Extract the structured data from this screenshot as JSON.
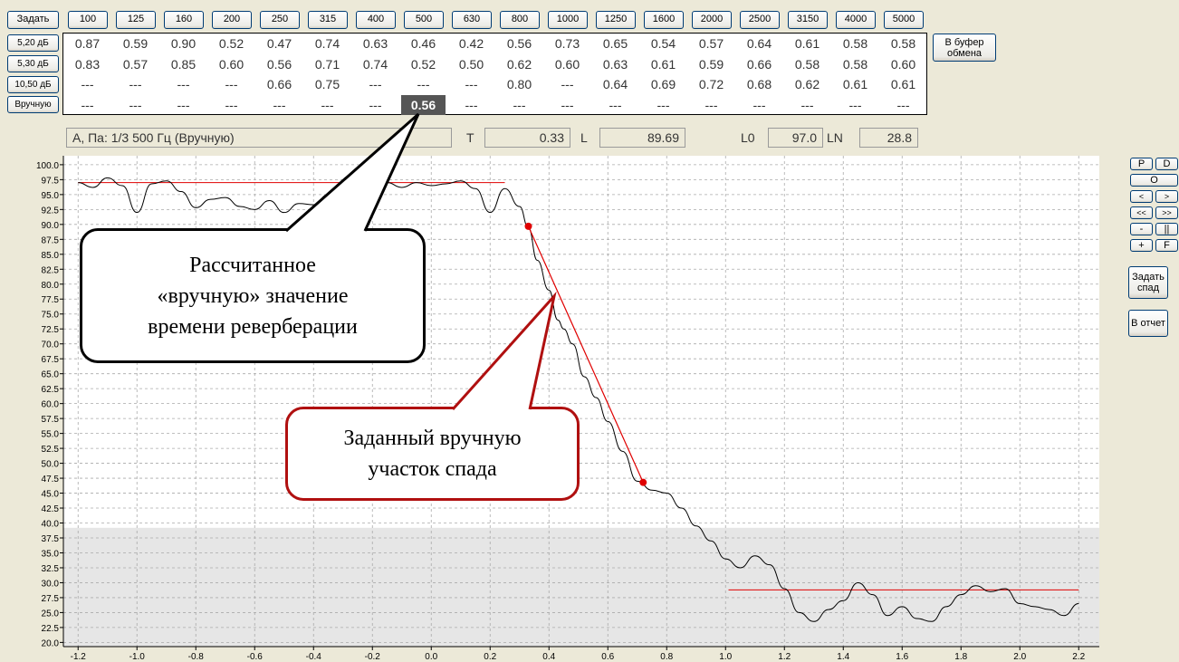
{
  "toolbar": {
    "set_label": "Задать"
  },
  "freq_headers": [
    "100",
    "125",
    "160",
    "200",
    "250",
    "315",
    "400",
    "500",
    "630",
    "800",
    "1000",
    "1250",
    "1600",
    "2000",
    "2500",
    "3150",
    "4000",
    "5000"
  ],
  "rows": [
    {
      "label": "5,20 дБ",
      "values": [
        "0.87",
        "0.59",
        "0.90",
        "0.52",
        "0.47",
        "0.74",
        "0.63",
        "0.46",
        "0.42",
        "0.56",
        "0.73",
        "0.65",
        "0.54",
        "0.57",
        "0.64",
        "0.61",
        "0.58",
        "0.58"
      ]
    },
    {
      "label": "5,30 дБ",
      "values": [
        "0.83",
        "0.57",
        "0.85",
        "0.60",
        "0.56",
        "0.71",
        "0.74",
        "0.52",
        "0.50",
        "0.62",
        "0.60",
        "0.63",
        "0.61",
        "0.59",
        "0.66",
        "0.58",
        "0.58",
        "0.60"
      ]
    },
    {
      "label": "10,50 дБ",
      "values": [
        "---",
        "---",
        "---",
        "---",
        "0.66",
        "0.75",
        "---",
        "---",
        "---",
        "0.80",
        "---",
        "0.64",
        "0.69",
        "0.72",
        "0.68",
        "0.62",
        "0.61",
        "0.61"
      ]
    },
    {
      "label": "Вручную",
      "values": [
        "---",
        "---",
        "---",
        "---",
        "---",
        "---",
        "---",
        "0.56",
        "---",
        "---",
        "---",
        "---",
        "---",
        "---",
        "---",
        "---",
        "---",
        "---"
      ],
      "highlight_index": 7
    }
  ],
  "clipboard_button": {
    "line1": "В буфер",
    "line2": "обмена"
  },
  "status": {
    "title": "А, Па: 1/3 500 Гц (Вручную)",
    "t_label": "T",
    "t_value": "0.33",
    "l_label": "L",
    "l_value": "89.69",
    "l0_label": "L0",
    "l0_value": "97.0",
    "ln_label": "LN",
    "ln_value": "28.8"
  },
  "side_buttons": {
    "p": "P",
    "d": "D",
    "o": "O",
    "lt": "<",
    "gt": ">",
    "llt": "<<",
    "ggt": ">>",
    "minus": "-",
    "pause": "||",
    "plus": "+",
    "f": "F",
    "set_decay_1": "Задать",
    "set_decay_2": "спад",
    "to_report": "В отчет"
  },
  "callouts": {
    "manual_value": [
      "Рассчитанное",
      "«вручную» значение",
      "времени реверберации"
    ],
    "manual_segment": [
      "Заданный вручную",
      "участок спада"
    ]
  },
  "chart_data": {
    "type": "line",
    "x_ticks": [
      "-1.2",
      "-1.0",
      "-0.8",
      "-0.6",
      "-0.4",
      "-0.2",
      "0.0",
      "0.2",
      "0.4",
      "0.6",
      "0.8",
      "1.0",
      "1.2",
      "1.4",
      "1.6",
      "1.8",
      "2.0",
      "2.2"
    ],
    "y_ticks": [
      "100.0",
      "97.5",
      "95.0",
      "92.5",
      "90.0",
      "87.5",
      "85.0",
      "82.5",
      "80.0",
      "77.5",
      "75.0",
      "72.5",
      "70.0",
      "67.5",
      "65.0",
      "62.5",
      "60.0",
      "57.5",
      "55.0",
      "52.5",
      "50.0",
      "47.5",
      "45.0",
      "42.5",
      "40.0",
      "37.5",
      "35.0",
      "32.5",
      "30.0",
      "27.5",
      "25.0",
      "22.5",
      "20.0"
    ],
    "xlim": [
      -1.25,
      2.27
    ],
    "ylim": [
      19.3,
      101.5
    ],
    "shaded_below": 39.2,
    "series": [
      {
        "x": [
          -1.2,
          -1.15,
          -1.1,
          -1.05,
          -1.0,
          -0.95,
          -0.9,
          -0.85,
          -0.8,
          -0.75,
          -0.7,
          -0.65,
          -0.6,
          -0.55,
          -0.5,
          -0.45,
          -0.4,
          -0.35,
          -0.3,
          -0.25,
          -0.2,
          -0.15,
          -0.1,
          -0.05,
          0.0,
          0.05,
          0.1,
          0.15,
          0.2,
          0.25,
          0.3,
          0.33,
          0.36,
          0.4,
          0.43,
          0.45,
          0.48,
          0.52,
          0.56,
          0.6,
          0.65,
          0.7,
          0.75,
          0.8,
          0.85,
          0.9,
          0.95,
          1.0,
          1.05,
          1.1,
          1.15,
          1.2,
          1.25,
          1.3,
          1.35,
          1.4,
          1.45,
          1.5,
          1.55,
          1.6,
          1.65,
          1.7,
          1.75,
          1.8,
          1.85,
          1.9,
          1.95,
          2.0,
          2.05,
          2.1,
          2.15,
          2.2
        ],
        "y": [
          97.0,
          96.2,
          97.8,
          96.5,
          92.0,
          96.8,
          97.3,
          95.5,
          92.8,
          94.2,
          94.5,
          93.0,
          92.5,
          94.0,
          92.0,
          93.5,
          93.3,
          95.0,
          94.5,
          96.0,
          94.2,
          97.0,
          96.2,
          97.0,
          96.5,
          96.8,
          97.3,
          96.0,
          92.0,
          96.0,
          93.0,
          89.5,
          84.0,
          79.0,
          74.0,
          72.5,
          70.0,
          64.5,
          61.0,
          57.0,
          52.0,
          47.0,
          45.5,
          45.0,
          42.5,
          39.5,
          37.0,
          34.0,
          32.5,
          34.5,
          33.0,
          29.0,
          25.0,
          23.5,
          25.5,
          27.0,
          30.0,
          28.0,
          24.5,
          26.0,
          24.0,
          23.5,
          26.0,
          28.0,
          29.5,
          28.5,
          29.0,
          26.5,
          26.0,
          25.5,
          24.5,
          26.5
        ]
      }
    ],
    "ref_lines": [
      {
        "x": [
          -1.2,
          0.25
        ],
        "y": [
          97.0,
          97.0
        ]
      },
      {
        "x": [
          1.01,
          2.2
        ],
        "y": [
          28.8,
          28.8
        ]
      }
    ],
    "decay_segment": {
      "x": [
        0.33,
        0.72
      ],
      "y": [
        89.69,
        46.8
      ]
    }
  },
  "colors": {
    "curve": "#000000",
    "ref_line": "#e00000",
    "marker": "#e00000",
    "shade": "#e6e6e6",
    "grid": "#aaaaaa",
    "callout1_border": "#000000",
    "callout2_border": "#b01010"
  }
}
